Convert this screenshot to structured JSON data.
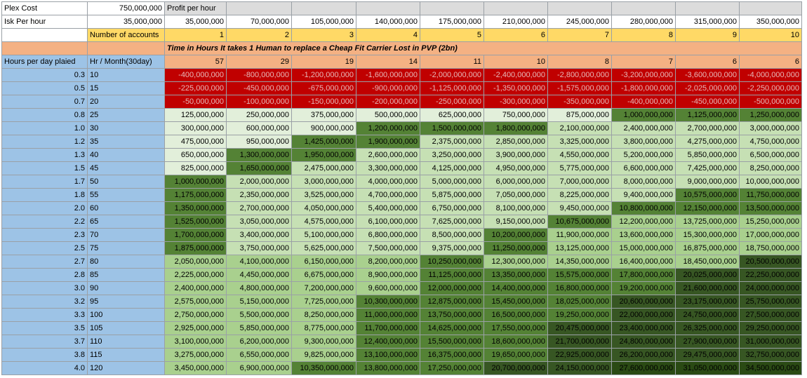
{
  "sheet": {
    "plex_label": "Plex Cost",
    "plex_value": "750,000,000",
    "profit_label": "Profit per hour",
    "isk_label": "Isk Per hour",
    "isk_value": "35,000,000",
    "profits": [
      "35,000,000",
      "70,000,000",
      "105,000,000",
      "140,000,000",
      "175,000,000",
      "210,000,000",
      "245,000,000",
      "280,000,000",
      "315,000,000",
      "350,000,000"
    ],
    "accounts_label": "Number of accounts",
    "accounts": [
      "1",
      "2",
      "3",
      "4",
      "5",
      "6",
      "7",
      "8",
      "9",
      "10"
    ],
    "subtitle": "Time in Hours It takes 1 Human to replace a Cheap Fit Carrier Lost in PVP (2bn)",
    "hours_label": "Hours per day plaied",
    "month_label": "Hr / Month(30day)",
    "replace_hours": [
      "57",
      "29",
      "19",
      "14",
      "11",
      "10",
      "8",
      "7",
      "6",
      "6"
    ],
    "rows": [
      {
        "h": "0.3",
        "m": "10",
        "v": [
          "-400,000,000",
          "-800,000,000",
          "-1,200,000,000",
          "-1,600,000,000",
          "-2,000,000,000",
          "-2,400,000,000",
          "-2,800,000,000",
          "-3,200,000,000",
          "-3,600,000,000",
          "-4,000,000,000"
        ],
        "s": [
          "red",
          "red",
          "red",
          "red",
          "red",
          "red",
          "red",
          "red",
          "red",
          "red"
        ]
      },
      {
        "h": "0.5",
        "m": "15",
        "v": [
          "-225,000,000",
          "-450,000,000",
          "-675,000,000",
          "-900,000,000",
          "-1,125,000,000",
          "-1,350,000,000",
          "-1,575,000,000",
          "-1,800,000,000",
          "-2,025,000,000",
          "-2,250,000,000"
        ],
        "s": [
          "red",
          "red",
          "red",
          "red",
          "red",
          "red",
          "red",
          "red",
          "red",
          "red"
        ]
      },
      {
        "h": "0.7",
        "m": "20",
        "v": [
          "-50,000,000",
          "-100,000,000",
          "-150,000,000",
          "-200,000,000",
          "-250,000,000",
          "-300,000,000",
          "-350,000,000",
          "-400,000,000",
          "-450,000,000",
          "-500,000,000"
        ],
        "s": [
          "red",
          "red",
          "red",
          "red",
          "red",
          "red",
          "red",
          "red",
          "red",
          "red"
        ]
      },
      {
        "h": "0.8",
        "m": "25",
        "v": [
          "125,000,000",
          "250,000,000",
          "375,000,000",
          "500,000,000",
          "625,000,000",
          "750,000,000",
          "875,000,000",
          "1,000,000,000",
          "1,125,000,000",
          "1,250,000,000"
        ],
        "s": [
          "g1",
          "g1",
          "g1",
          "g1",
          "g1",
          "g1",
          "g1",
          "g4",
          "g4",
          "g4"
        ]
      },
      {
        "h": "1.0",
        "m": "30",
        "v": [
          "300,000,000",
          "600,000,000",
          "900,000,000",
          "1,200,000,000",
          "1,500,000,000",
          "1,800,000,000",
          "2,100,000,000",
          "2,400,000,000",
          "2,700,000,000",
          "3,000,000,000"
        ],
        "s": [
          "g1",
          "g1",
          "g1",
          "g4",
          "g4",
          "g4",
          "g2",
          "g2",
          "g2",
          "g2"
        ]
      },
      {
        "h": "1.2",
        "m": "35",
        "v": [
          "475,000,000",
          "950,000,000",
          "1,425,000,000",
          "1,900,000,000",
          "2,375,000,000",
          "2,850,000,000",
          "3,325,000,000",
          "3,800,000,000",
          "4,275,000,000",
          "4,750,000,000"
        ],
        "s": [
          "g1",
          "g1",
          "g4",
          "g4",
          "g2",
          "g2",
          "g2",
          "g2",
          "g2",
          "g2"
        ]
      },
      {
        "h": "1.3",
        "m": "40",
        "v": [
          "650,000,000",
          "1,300,000,000",
          "1,950,000,000",
          "2,600,000,000",
          "3,250,000,000",
          "3,900,000,000",
          "4,550,000,000",
          "5,200,000,000",
          "5,850,000,000",
          "6,500,000,000"
        ],
        "s": [
          "g1",
          "g4",
          "g4",
          "g2",
          "g2",
          "g2",
          "g2",
          "g2",
          "g2",
          "g2"
        ]
      },
      {
        "h": "1.5",
        "m": "45",
        "v": [
          "825,000,000",
          "1,650,000,000",
          "2,475,000,000",
          "3,300,000,000",
          "4,125,000,000",
          "4,950,000,000",
          "5,775,000,000",
          "6,600,000,000",
          "7,425,000,000",
          "8,250,000,000"
        ],
        "s": [
          "g1",
          "g4",
          "g2",
          "g2",
          "g2",
          "g2",
          "g2",
          "g2",
          "g2",
          "g2"
        ]
      },
      {
        "h": "1.7",
        "m": "50",
        "v": [
          "1,000,000,000",
          "2,000,000,000",
          "3,000,000,000",
          "4,000,000,000",
          "5,000,000,000",
          "6,000,000,000",
          "7,000,000,000",
          "8,000,000,000",
          "9,000,000,000",
          "10,000,000,000"
        ],
        "s": [
          "g4",
          "g2",
          "g2",
          "g2",
          "g2",
          "g2",
          "g2",
          "g2",
          "g2",
          "g2"
        ]
      },
      {
        "h": "1.8",
        "m": "55",
        "v": [
          "1,175,000,000",
          "2,350,000,000",
          "3,525,000,000",
          "4,700,000,000",
          "5,875,000,000",
          "7,050,000,000",
          "8,225,000,000",
          "9,400,000,000",
          "10,575,000,000",
          "11,750,000,000"
        ],
        "s": [
          "g4",
          "g2",
          "g2",
          "g2",
          "g2",
          "g2",
          "g2",
          "g2",
          "g4",
          "g4"
        ]
      },
      {
        "h": "2.0",
        "m": "60",
        "v": [
          "1,350,000,000",
          "2,700,000,000",
          "4,050,000,000",
          "5,400,000,000",
          "6,750,000,000",
          "8,100,000,000",
          "9,450,000,000",
          "10,800,000,000",
          "12,150,000,000",
          "13,500,000,000"
        ],
        "s": [
          "g4",
          "g2",
          "g2",
          "g2",
          "g2",
          "g2",
          "g2",
          "g4",
          "g4",
          "g4"
        ]
      },
      {
        "h": "2.2",
        "m": "65",
        "v": [
          "1,525,000,000",
          "3,050,000,000",
          "4,575,000,000",
          "6,100,000,000",
          "7,625,000,000",
          "9,150,000,000",
          "10,675,000,000",
          "12,200,000,000",
          "13,725,000,000",
          "15,250,000,000"
        ],
        "s": [
          "g4",
          "g2",
          "g2",
          "g2",
          "g2",
          "g2",
          "g4",
          "g3",
          "g3",
          "g3"
        ]
      },
      {
        "h": "2.3",
        "m": "70",
        "v": [
          "1,700,000,000",
          "3,400,000,000",
          "5,100,000,000",
          "6,800,000,000",
          "8,500,000,000",
          "10,200,000,000",
          "11,900,000,000",
          "13,600,000,000",
          "15,300,000,000",
          "17,000,000,000"
        ],
        "s": [
          "g4",
          "g2",
          "g2",
          "g2",
          "g2",
          "g4",
          "g3",
          "g3",
          "g3",
          "g3"
        ]
      },
      {
        "h": "2.5",
        "m": "75",
        "v": [
          "1,875,000,000",
          "3,750,000,000",
          "5,625,000,000",
          "7,500,000,000",
          "9,375,000,000",
          "11,250,000,000",
          "13,125,000,000",
          "15,000,000,000",
          "16,875,000,000",
          "18,750,000,000"
        ],
        "s": [
          "g4",
          "g2",
          "g2",
          "g2",
          "g2",
          "g4",
          "g3",
          "g3",
          "g3",
          "g3"
        ]
      },
      {
        "h": "2.7",
        "m": "80",
        "v": [
          "2,050,000,000",
          "4,100,000,000",
          "6,150,000,000",
          "8,200,000,000",
          "10,250,000,000",
          "12,300,000,000",
          "14,350,000,000",
          "16,400,000,000",
          "18,450,000,000",
          "20,500,000,000"
        ],
        "s": [
          "g3",
          "g3",
          "g3",
          "g3",
          "g4",
          "g3",
          "g3",
          "g3",
          "g3",
          "g5"
        ]
      },
      {
        "h": "2.8",
        "m": "85",
        "v": [
          "2,225,000,000",
          "4,450,000,000",
          "6,675,000,000",
          "8,900,000,000",
          "11,125,000,000",
          "13,350,000,000",
          "15,575,000,000",
          "17,800,000,000",
          "20,025,000,000",
          "22,250,000,000"
        ],
        "s": [
          "g3",
          "g3",
          "g3",
          "g3",
          "g4",
          "g4",
          "g4",
          "g4",
          "g5",
          "g5"
        ]
      },
      {
        "h": "3.0",
        "m": "90",
        "v": [
          "2,400,000,000",
          "4,800,000,000",
          "7,200,000,000",
          "9,600,000,000",
          "12,000,000,000",
          "14,400,000,000",
          "16,800,000,000",
          "19,200,000,000",
          "21,600,000,000",
          "24,000,000,000"
        ],
        "s": [
          "g3",
          "g3",
          "g3",
          "g3",
          "g4",
          "g4",
          "g4",
          "g4",
          "g5",
          "g5"
        ]
      },
      {
        "h": "3.2",
        "m": "95",
        "v": [
          "2,575,000,000",
          "5,150,000,000",
          "7,725,000,000",
          "10,300,000,000",
          "12,875,000,000",
          "15,450,000,000",
          "18,025,000,000",
          "20,600,000,000",
          "23,175,000,000",
          "25,750,000,000"
        ],
        "s": [
          "g3",
          "g3",
          "g3",
          "g4",
          "g4",
          "g4",
          "g4",
          "g5",
          "g5",
          "g5"
        ]
      },
      {
        "h": "3.3",
        "m": "100",
        "v": [
          "2,750,000,000",
          "5,500,000,000",
          "8,250,000,000",
          "11,000,000,000",
          "13,750,000,000",
          "16,500,000,000",
          "19,250,000,000",
          "22,000,000,000",
          "24,750,000,000",
          "27,500,000,000"
        ],
        "s": [
          "g3",
          "g3",
          "g3",
          "g4",
          "g4",
          "g4",
          "g4",
          "g5",
          "g5",
          "g5"
        ]
      },
      {
        "h": "3.5",
        "m": "105",
        "v": [
          "2,925,000,000",
          "5,850,000,000",
          "8,775,000,000",
          "11,700,000,000",
          "14,625,000,000",
          "17,550,000,000",
          "20,475,000,000",
          "23,400,000,000",
          "26,325,000,000",
          "29,250,000,000"
        ],
        "s": [
          "g3",
          "g3",
          "g3",
          "g4",
          "g4",
          "g4",
          "g5",
          "g5",
          "g5",
          "g5"
        ]
      },
      {
        "h": "3.7",
        "m": "110",
        "v": [
          "3,100,000,000",
          "6,200,000,000",
          "9,300,000,000",
          "12,400,000,000",
          "15,500,000,000",
          "18,600,000,000",
          "21,700,000,000",
          "24,800,000,000",
          "27,900,000,000",
          "31,000,000,000"
        ],
        "s": [
          "g3",
          "g3",
          "g3",
          "g4",
          "g4",
          "g4",
          "g5",
          "g5",
          "g5",
          "g5"
        ]
      },
      {
        "h": "3.8",
        "m": "115",
        "v": [
          "3,275,000,000",
          "6,550,000,000",
          "9,825,000,000",
          "13,100,000,000",
          "16,375,000,000",
          "19,650,000,000",
          "22,925,000,000",
          "26,200,000,000",
          "29,475,000,000",
          "32,750,000,000"
        ],
        "s": [
          "g3",
          "g3",
          "g3",
          "g4",
          "g4",
          "g4",
          "g5",
          "g5",
          "g5",
          "g5"
        ]
      },
      {
        "h": "4.0",
        "m": "120",
        "v": [
          "3,450,000,000",
          "6,900,000,000",
          "10,350,000,000",
          "13,800,000,000",
          "17,250,000,000",
          "20,700,000,000",
          "24,150,000,000",
          "27,600,000,000",
          "31,050,000,000",
          "34,500,000,000"
        ],
        "s": [
          "g3",
          "g3",
          "g4",
          "g4",
          "g4",
          "g5",
          "g5",
          "g6",
          "g6",
          "g6"
        ]
      }
    ]
  }
}
